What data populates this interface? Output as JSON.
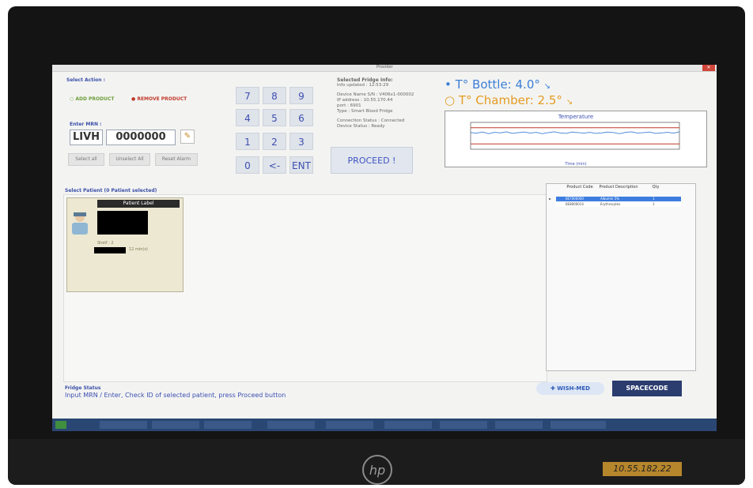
{
  "window": {
    "title": "Provider"
  },
  "actions": {
    "select_action_label": "Select Action :",
    "add_product": "ADD PRODUCT",
    "remove_product": "REMOVE PRODUCT"
  },
  "mrn": {
    "label": "Enter MRN :",
    "prefix": "LIVH",
    "value": "0000000"
  },
  "buttons": {
    "select_all": "Select all",
    "unselect_all": "Unselect All",
    "reset_alarm": "Reset Alarm",
    "proceed": "PROCEED !"
  },
  "keypad": [
    "7",
    "8",
    "9",
    "4",
    "5",
    "6",
    "1",
    "2",
    "3",
    "0",
    "<-",
    "ENT"
  ],
  "fridge": {
    "title": "Selected Fridge Info:",
    "updated": "Info updated : 12:53:29",
    "device_name": "Device Name S/N : V406x1-000002",
    "ip": "IP address : 10.55.170.44",
    "port": "port : 6901",
    "type": "Type : Smart Blood Fridge",
    "connection": "Connection Status : Connected",
    "device_status": "Device Status : Ready"
  },
  "temps": {
    "bottle": "T° Bottle: 4.0°",
    "chamber": "T° Chamber: 2.5°"
  },
  "chart_data": {
    "type": "line",
    "title": "Temperature",
    "xlabel": "Time (min)",
    "ylabel": "",
    "ylim": [
      0,
      10
    ],
    "series": [
      {
        "values": [
          6.2,
          6.0,
          6.4,
          5.8,
          6.3,
          6.1,
          6.5,
          5.9,
          6.2,
          6.4,
          6.0,
          6.3,
          5.8,
          6.2,
          6.5,
          6.1,
          5.9,
          6.4,
          6.2,
          6.0,
          6.3,
          5.9,
          6.1,
          6.4,
          6.2,
          5.8,
          6.3,
          6.5,
          6.0,
          6.2,
          6.4,
          5.9,
          6.1,
          6.3,
          6.0,
          6.5
        ]
      }
    ],
    "thresholds": [
      {
        "value": 8.0,
        "color": "#c0392b"
      },
      {
        "value": 2.0,
        "color": "#c0392b"
      }
    ],
    "colors": {
      "series": "#3c7fd6",
      "threshold": "#c0392b"
    }
  },
  "patients": {
    "header": "Select Patient (0 Patient selected)",
    "card": {
      "label": "Patient Label",
      "shelf": "Shelf : 2",
      "time": "12 min(s)"
    }
  },
  "products": {
    "headers": [
      "Product Code",
      "Product Description",
      "Qty"
    ],
    "rows": [
      {
        "code": "6E7000000",
        "description": "Albumin 5%",
        "qty": "1"
      },
      {
        "code": "6E8000014",
        "description": "Erythrocytes",
        "qty": "1"
      }
    ]
  },
  "status": {
    "label": "Fridge Status",
    "message": "Input MRN / Enter, Check ID of selected patient, press Proceed button"
  },
  "logos": {
    "wishmed": "WISH-MED",
    "spacecode": "SPACECODE"
  },
  "monitor": {
    "ip_sticker": "10.55.182.22",
    "brand": "hp"
  },
  "colors": {
    "accent_blue": "#3c4fb0",
    "bottle_temp": "#3c7fd6",
    "chamber_temp": "#e59b22",
    "add_product": "#6e9d3a",
    "remove_product": "#c0392b"
  }
}
